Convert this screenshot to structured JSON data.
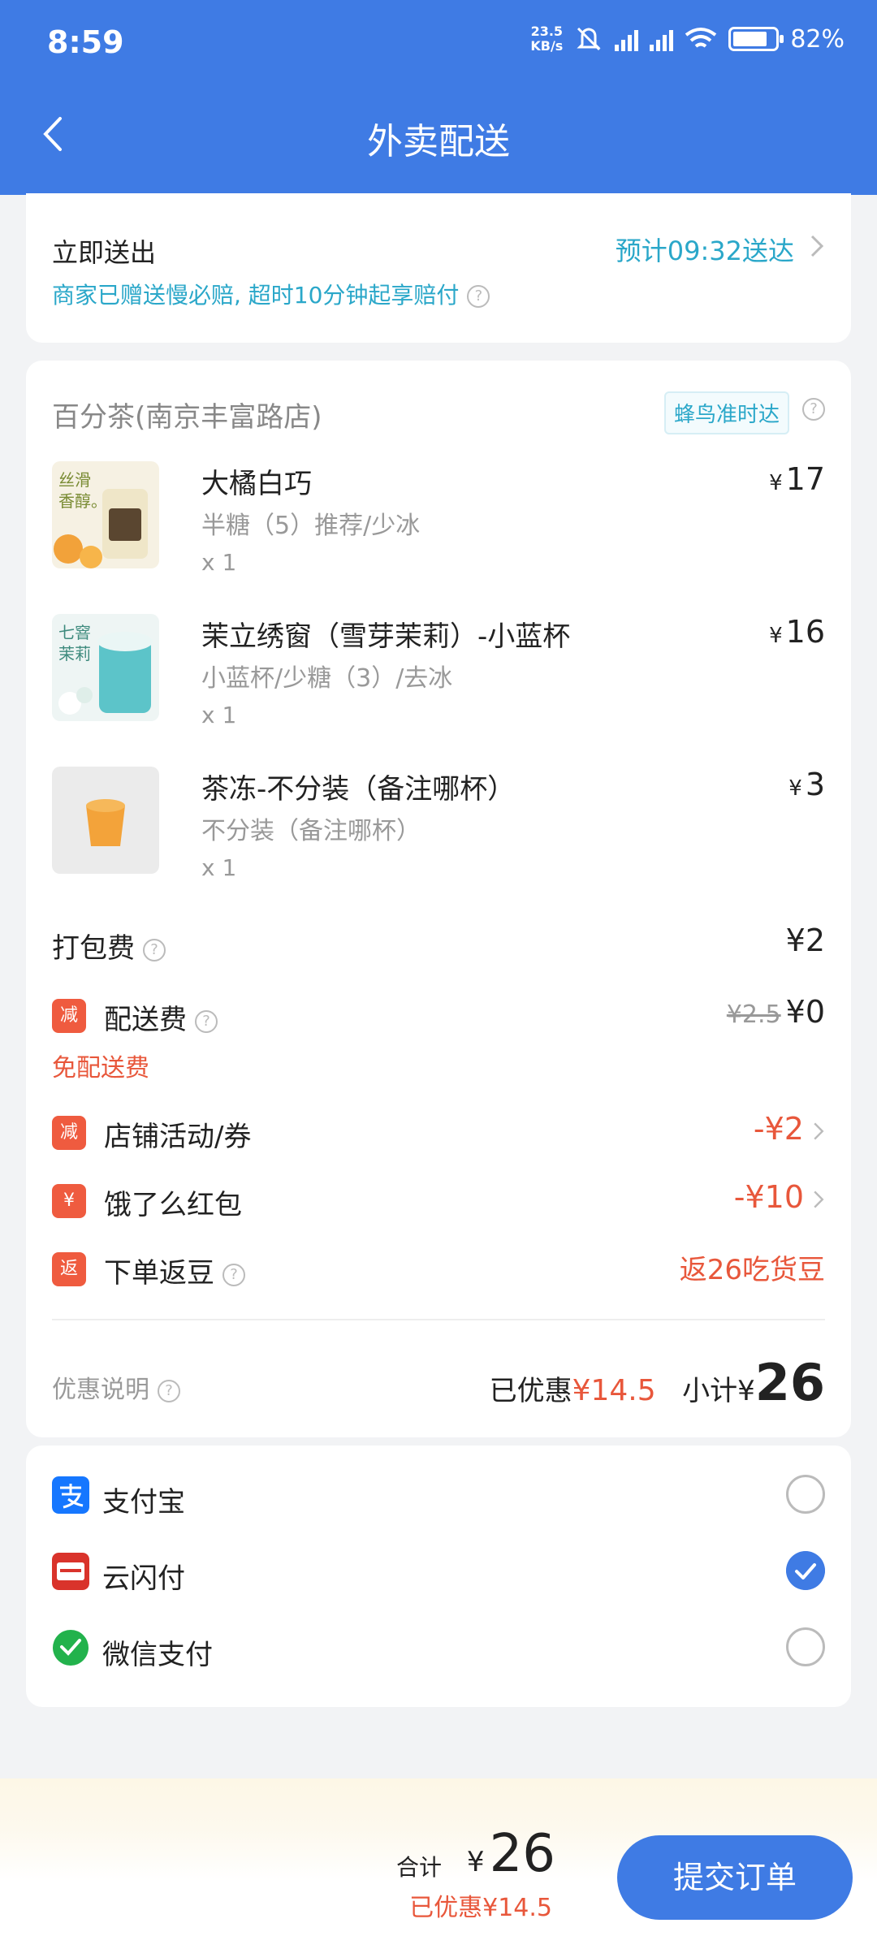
{
  "status_bar": {
    "time": "8:59",
    "net_speed_top": "23.5",
    "net_speed_bottom": "KB/s",
    "battery": "82%"
  },
  "header": {
    "title": "外卖配送"
  },
  "delivery": {
    "mode": "立即送出",
    "promise": "商家已赠送慢必赔, 超时10分钟起享赔付",
    "eta": "预计09:32送达"
  },
  "store": {
    "name": "百分茶(南京丰富路店)",
    "tag": "蜂鸟准时达"
  },
  "items": [
    {
      "name": "大橘白巧",
      "spec": "半糖（5）推荐/少冰",
      "qty": "x 1",
      "currency": "¥",
      "price": "17"
    },
    {
      "name": "茉立绣窗（雪芽茉莉）-小蓝杯",
      "spec": "小蓝杯/少糖（3）/去冰",
      "qty": "x 1",
      "currency": "¥",
      "price": "16"
    },
    {
      "name": "茶冻-不分装（备注哪杯）",
      "spec": "不分装（备注哪杯）",
      "qty": "x 1",
      "currency": "¥",
      "price": "3"
    }
  ],
  "thumb_text": {
    "item1_line1": "丝滑",
    "item1_line2": "香醇。",
    "item2_line1": "七窨",
    "item2_line2": "茉莉"
  },
  "fees": {
    "packing_label": "打包费",
    "packing_value": "¥2",
    "delivery_badge": "减",
    "delivery_label": "配送费",
    "delivery_original": "¥2.5",
    "delivery_value": "¥0",
    "delivery_free_note": "免配送费",
    "store_badge": "减",
    "store_label": "店铺活动/券",
    "store_value": "-¥2",
    "redpack_badge": "¥",
    "redpack_label": "饿了么红包",
    "redpack_value": "-¥10",
    "beans_badge": "返",
    "beans_label": "下单返豆",
    "beans_value": "返26吃货豆"
  },
  "summary": {
    "note": "优惠说明",
    "saved_label": "已优惠",
    "saved_value": "¥14.5",
    "subtotal_label": "小计¥",
    "subtotal_value": "26"
  },
  "payment": [
    {
      "label": "支付宝",
      "selected": false
    },
    {
      "label": "云闪付",
      "selected": true
    },
    {
      "label": "微信支付",
      "selected": false
    }
  ],
  "bottom": {
    "total_label": "合计",
    "total_currency": "¥",
    "total_value": "26",
    "discount": "已优惠¥14.5",
    "submit_label": "提交订单"
  },
  "colors": {
    "primary": "#3f7be4",
    "accent_red": "#e8573b",
    "teal": "#2aa7c9"
  }
}
